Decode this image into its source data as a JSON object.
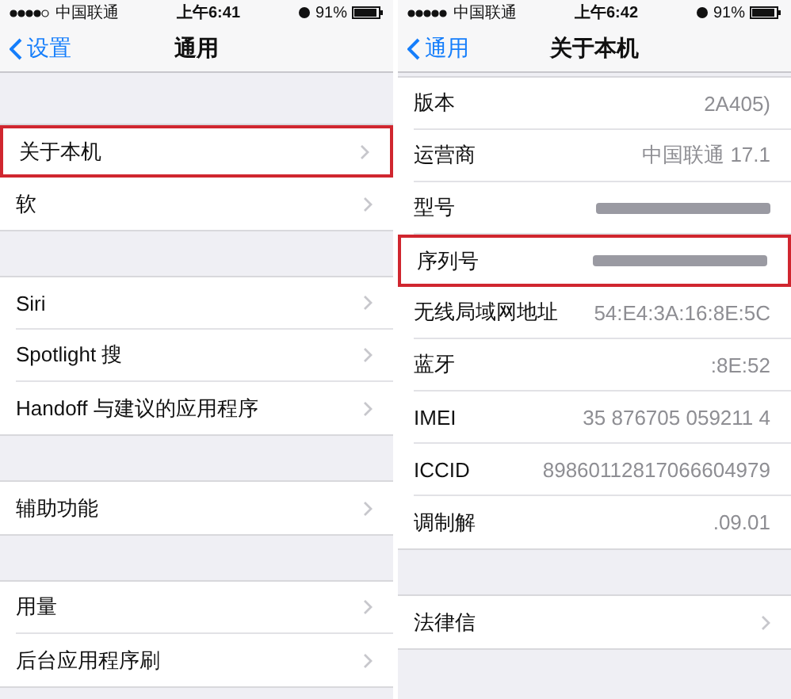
{
  "screens": [
    {
      "status_bar": {
        "carrier": "中国联通",
        "time": "上午6:41",
        "battery": "91%"
      },
      "nav": {
        "back": "设置",
        "title": "通用"
      },
      "sections": [
        [
          {
            "label": "关于本机",
            "highlighted": true,
            "disclosure": true
          },
          {
            "label": "软",
            "highlighted": false,
            "disclosure": true
          }
        ],
        [
          {
            "label": "Siri",
            "highlighted": false,
            "disclosure": true
          },
          {
            "label": "Spotlight 搜",
            "highlighted": false,
            "disclosure": true
          },
          {
            "label": "Handoff 与建议的应用程序",
            "highlighted": false,
            "disclosure": true
          }
        ],
        [
          {
            "label": "辅助功能",
            "highlighted": false,
            "disclosure": true
          }
        ],
        [
          {
            "label": "用量",
            "highlighted": false,
            "disclosure": true
          },
          {
            "label": "后台应用程序刷",
            "highlighted": false,
            "disclosure": true
          }
        ]
      ]
    },
    {
      "status_bar": {
        "carrier": "中国联通",
        "time": "上午6:42",
        "battery": "91%"
      },
      "nav": {
        "back": "通用",
        "title": "关于本机"
      },
      "sections": [
        [
          {
            "label": "版本",
            "value": "2A405)",
            "highlighted": false,
            "disclosure": false
          },
          {
            "label": "运营商",
            "value": "中国联通 17.1",
            "highlighted": false,
            "disclosure": false
          },
          {
            "label": "型号",
            "redacted": true,
            "highlighted": false,
            "disclosure": false
          },
          {
            "label": "序列号",
            "redacted": true,
            "highlighted": true,
            "disclosure": false
          },
          {
            "label": "无线局域网地址",
            "value": "54:E4:3A:16:8E:5C",
            "highlighted": false,
            "disclosure": false
          },
          {
            "label": "蓝牙",
            "value": ":8E:52",
            "highlighted": false,
            "disclosure": false
          },
          {
            "label": "IMEI",
            "value": "35 876705 059211 4",
            "highlighted": false,
            "disclosure": false
          },
          {
            "label": "ICCID",
            "value": "89860112817066604979",
            "highlighted": false,
            "disclosure": false
          },
          {
            "label": "调制解",
            "value": ".09.01",
            "highlighted": false,
            "disclosure": false
          }
        ],
        [
          {
            "label": "法律信",
            "highlighted": false,
            "disclosure": true
          }
        ]
      ]
    }
  ]
}
